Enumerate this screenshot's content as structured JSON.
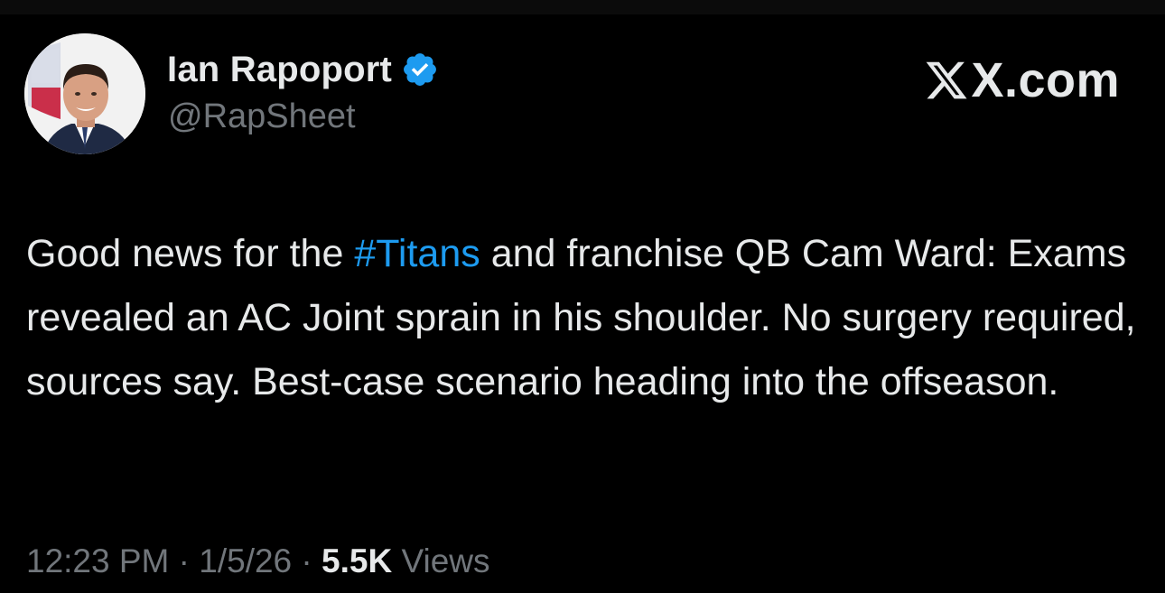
{
  "author": {
    "display_name": "Ian Rapoport",
    "handle": "@RapSheet",
    "verified": true,
    "avatar_icon": "person-photo-avatar-icon"
  },
  "brand": {
    "label": "X.com",
    "icon": "x-logo-icon"
  },
  "tweet": {
    "text_before_hashtag": "Good news for the ",
    "hashtag": "#Titans",
    "text_after_hashtag": " and franchise QB Cam Ward: Exams revealed an AC Joint sprain in his shoulder. No surgery required, sources say. Best-case scenario heading into the offseason."
  },
  "meta": {
    "time": "12:23 PM",
    "separator": " · ",
    "date": "1/5/26",
    "views_count": "5.5K",
    "views_label": " Views"
  },
  "colors": {
    "background": "#000000",
    "text_primary": "#e7e9ea",
    "text_secondary": "#71767b",
    "link": "#1d9bf0",
    "verified_badge": "#1d9bf0"
  }
}
